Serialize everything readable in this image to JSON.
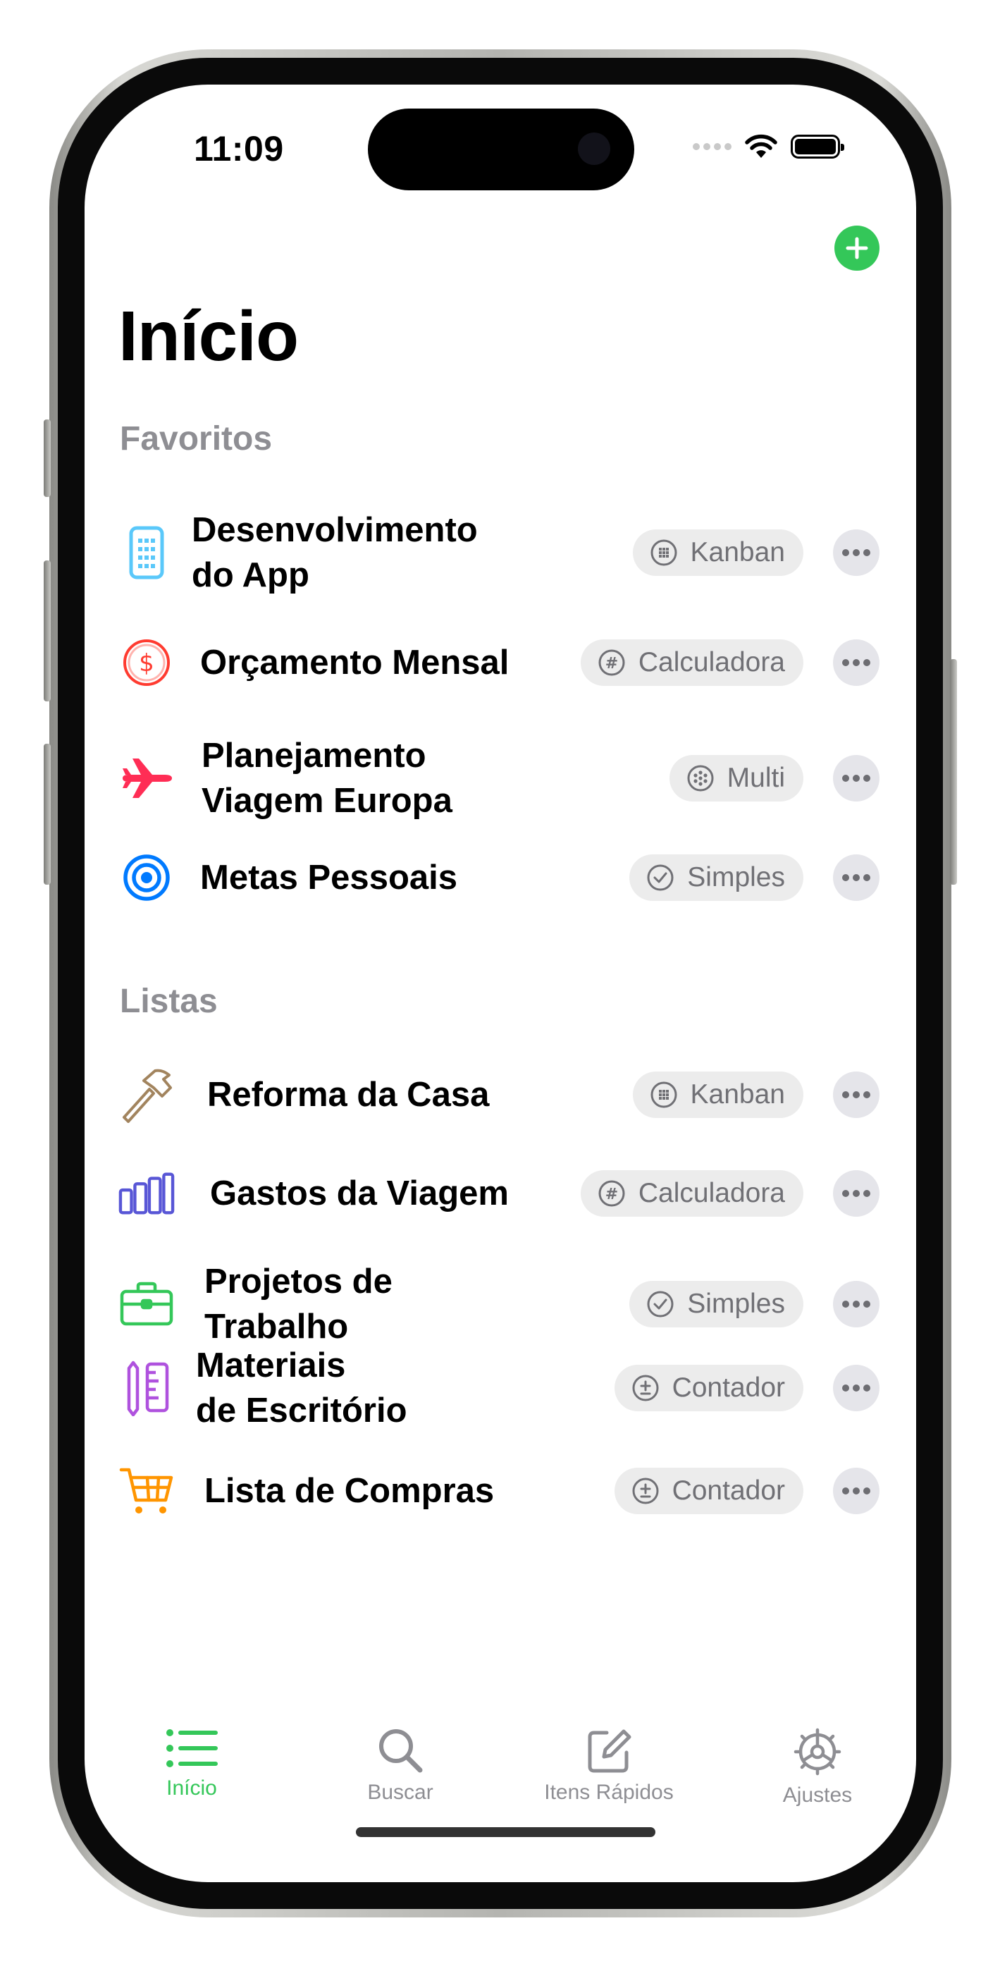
{
  "status_bar": {
    "time": "11:09"
  },
  "header": {
    "title": "Início",
    "add_label": "+"
  },
  "favorites": {
    "title": "Favoritos",
    "items": [
      {
        "line1": "Desenvolvimento",
        "line2": "do App",
        "badge": "Kanban",
        "icon": "phone-icon",
        "color": "#5ac8fa"
      },
      {
        "line1": "Orçamento Mensal",
        "line2": "",
        "badge": "Calculadora",
        "icon": "dollar-circle-icon",
        "color": "#ff3b30"
      },
      {
        "line1": "Planejamento",
        "line2": "Viagem Europa",
        "badge": "Multi",
        "icon": "airplane-icon",
        "color": "#ff2d55"
      },
      {
        "line1": "Metas Pessoais",
        "line2": "",
        "badge": "Simples",
        "icon": "target-icon",
        "color": "#007aff"
      }
    ]
  },
  "lists": {
    "title": "Listas",
    "items": [
      {
        "line1": "Reforma da Casa",
        "line2": "",
        "badge": "Kanban",
        "icon": "hammer-icon",
        "color": "#a2845e"
      },
      {
        "line1": "Gastos da Viagem",
        "line2": "",
        "badge": "Calculadora",
        "icon": "bar-chart-icon",
        "color": "#5856d6"
      },
      {
        "line1": "Projetos de Trabalho",
        "line2": "",
        "badge": "Simples",
        "icon": "briefcase-icon",
        "color": "#34c759"
      },
      {
        "line1": "Materiais",
        "line2": "de Escritório",
        "badge": "Contador",
        "icon": "pencil-ruler-icon",
        "color": "#af52de"
      },
      {
        "line1": "Lista de Compras",
        "line2": "",
        "badge": "Contador",
        "icon": "cart-icon",
        "color": "#ff9500"
      }
    ]
  },
  "tabbar": {
    "tabs": [
      {
        "label": "Início",
        "icon": "list-icon",
        "active": true
      },
      {
        "label": "Buscar",
        "icon": "search-icon",
        "active": false
      },
      {
        "label": "Itens Rápidos",
        "icon": "compose-icon",
        "active": false
      },
      {
        "label": "Ajustes",
        "icon": "gear-icon",
        "active": false
      }
    ]
  },
  "colors": {
    "accent": "#34c759",
    "secondary_text": "#8e8e93",
    "badge_bg": "#ececec"
  }
}
